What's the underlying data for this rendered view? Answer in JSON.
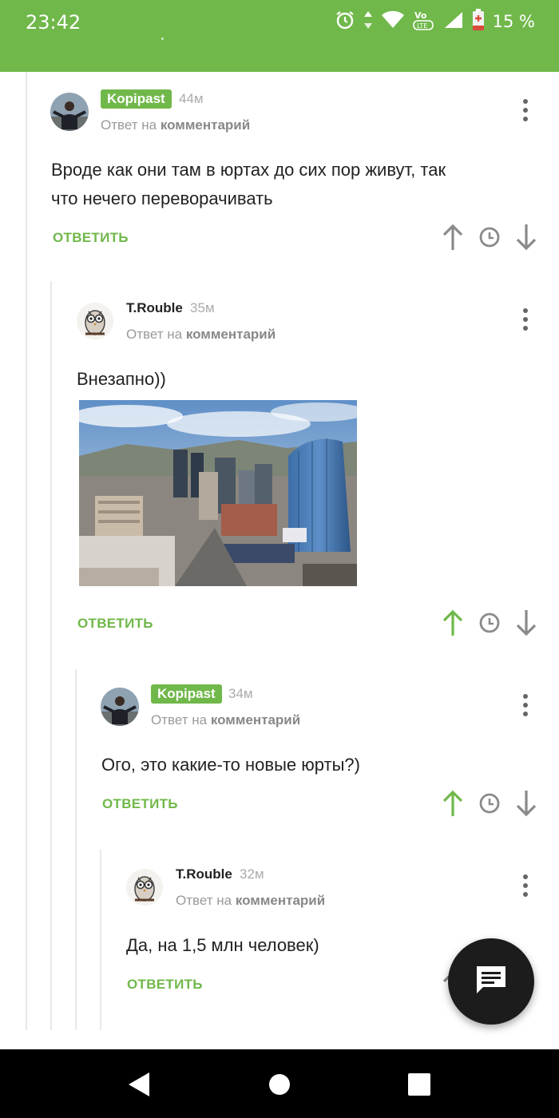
{
  "status_bar": {
    "time": "23:42",
    "battery_text": "15 %",
    "bg_color": "#70b84a"
  },
  "labels": {
    "reply_to_prefix": "Ответ на",
    "reply_to_target": "комментарий",
    "reply_action": "ОТВЕТИТЬ"
  },
  "comments": [
    {
      "author": "Kopipast",
      "author_badge": true,
      "age": "44м",
      "text_lines": [
        "Вроде как они там в юртах до сих пор живут, так",
        "что нечего переворачивать"
      ],
      "upvote_active": false
    },
    {
      "author": "T.Rouble",
      "author_badge": false,
      "age": "35м",
      "text_lines": [
        "Внезапно))"
      ],
      "has_image": true,
      "upvote_active": true
    },
    {
      "author": "Kopipast",
      "author_badge": true,
      "age": "34м",
      "text_lines": [
        "Ого, это какие-то новые юрты?)"
      ],
      "upvote_active": true
    },
    {
      "author": "T.Rouble",
      "author_badge": false,
      "age": "32м",
      "text_lines": [
        "Да, на 1,5 млн человек)"
      ],
      "upvote_active": false
    }
  ],
  "colors": {
    "accent_green": "#70b84a",
    "icon_gray": "#8a8a8a",
    "fab_bg": "#1c1c1c"
  },
  "icons": {
    "upvote": "arrow-up-icon",
    "save": "clock-icon",
    "downvote": "arrow-down-icon",
    "more": "more-vertical-icon",
    "fab": "message-icon"
  }
}
